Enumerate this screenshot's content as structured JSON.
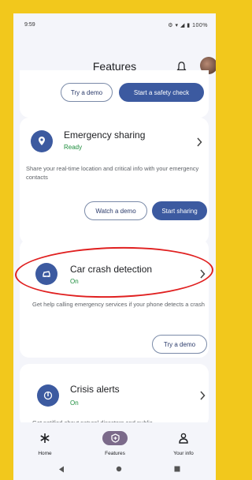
{
  "status_bar": {
    "time": "9:59",
    "icons": "⚙ ▾ ◢ ▮ 100%"
  },
  "header": {
    "title": "Features"
  },
  "safety_check_card": {
    "try_demo": "Try a demo",
    "start_check": "Start a safety check"
  },
  "emergency_sharing": {
    "title": "Emergency sharing",
    "status": "Ready",
    "description": "Share your real-time location and critical info with your emergency contacts",
    "watch_demo": "Watch a demo",
    "start_sharing": "Start sharing"
  },
  "car_crash": {
    "title": "Car crash detection",
    "status": "On",
    "description": "Get help calling emergency services if your phone detects a crash",
    "try_demo": "Try a demo"
  },
  "crisis_alerts": {
    "title": "Crisis alerts",
    "status": "On",
    "description": "Get notified about natural disasters and public"
  },
  "bottom_nav": {
    "home": "Home",
    "features": "Features",
    "your_info": "Your info"
  },
  "colors": {
    "accent": "#3c5aa0",
    "status_on": "#1e8e3e",
    "highlight_oval": "#e02020",
    "frame": "#f2c81c"
  }
}
